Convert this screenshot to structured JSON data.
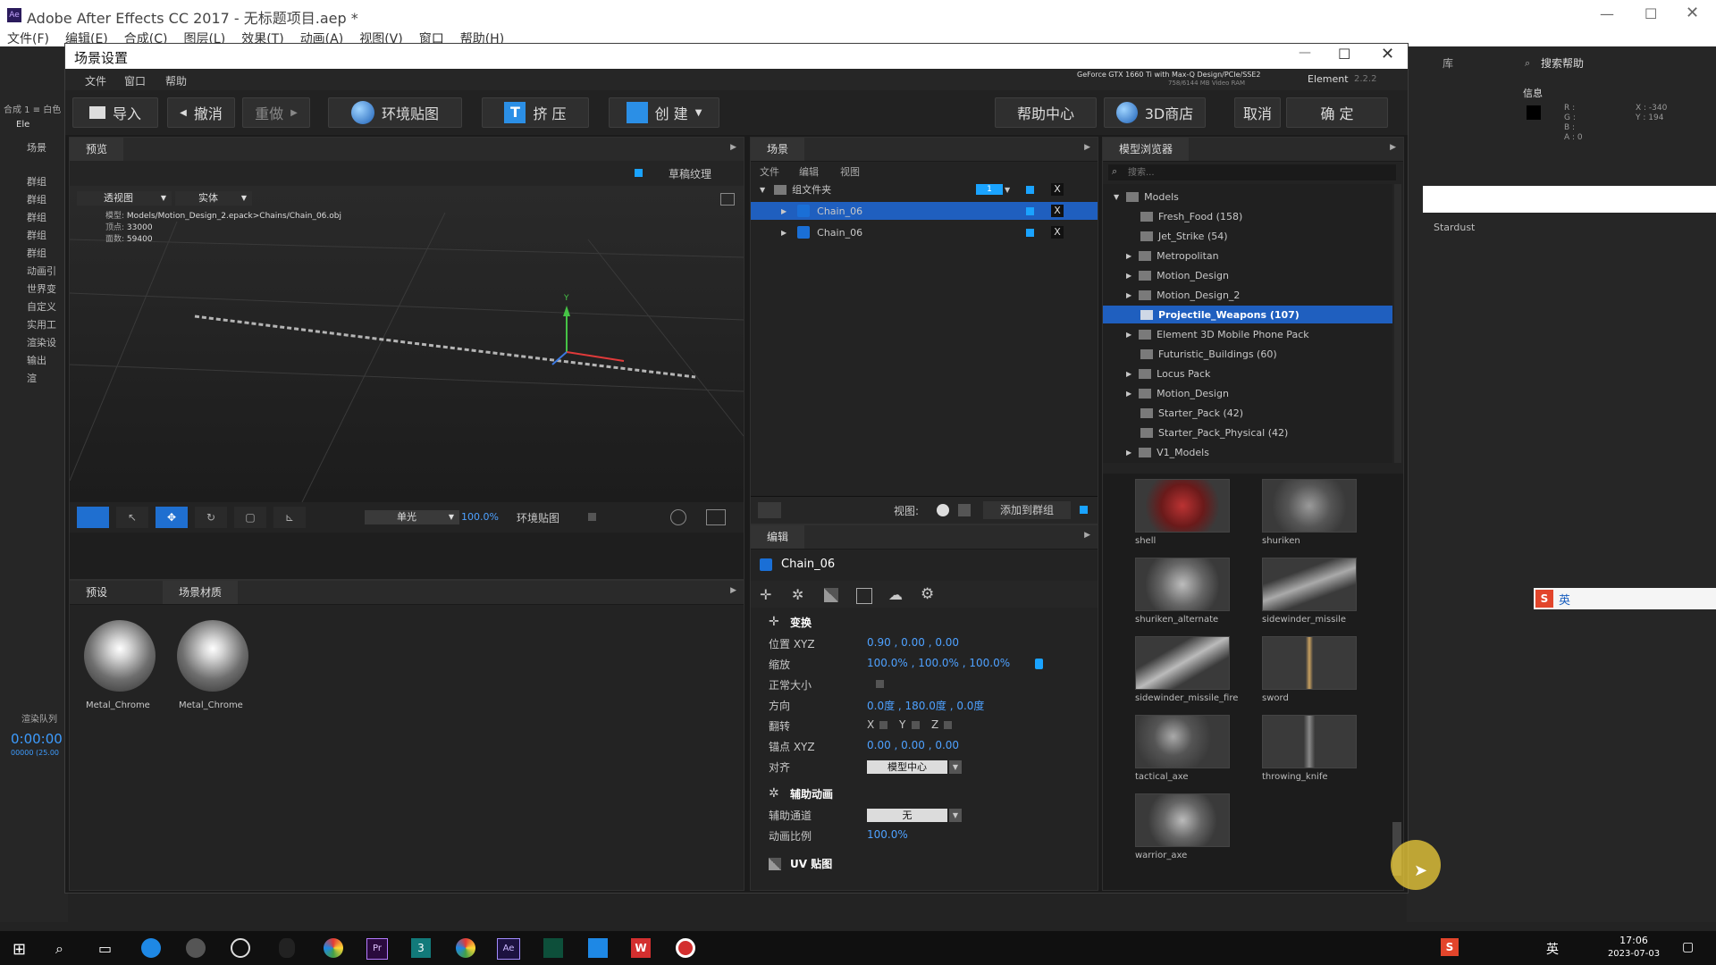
{
  "ae": {
    "title": "Adobe After Effects CC 2017 - 无标题项目.aep *",
    "menu": [
      "文件(F)",
      "编辑(E)",
      "合成(C)",
      "图层(L)",
      "效果(T)",
      "动画(A)",
      "视图(V)",
      "窗口",
      "帮助(H)"
    ],
    "search_label": "搜索帮助",
    "library_label": "库",
    "info_label": "信息",
    "info_rgba": [
      "R :",
      "G :",
      "B :",
      "A : 0"
    ],
    "info_x": "X : -340",
    "info_y": "Y : 194",
    "stardust_label": "Stardust",
    "left_panel": {
      "comp": "合成 1 ≡ 白色",
      "fx": "Ele",
      "items": [
        "场景",
        "群组",
        "群组",
        "群组",
        "群组",
        "群组",
        "动画引",
        "世界变",
        "自定义",
        "实用工",
        "渲染设",
        "输出",
        "渲"
      ],
      "render": "渲染队列",
      "timecode": "0:00:00",
      "timecode_sub": "00000 (25.00"
    }
  },
  "dialog": {
    "title": "场景设置",
    "menu": [
      "文件",
      "窗口",
      "帮助"
    ],
    "gpu": "GeForce GTX 1660 Ti with Max-Q Design/PCIe/SSE2",
    "gpu_mem": "758/6144 MB Video RAM",
    "element": "Element",
    "element_ver": "2.2.2",
    "toolbar": {
      "import": "导入",
      "undo": "撤消",
      "redo": "重做",
      "env": "环境贴图",
      "extrude": "挤 压",
      "create": "创 建",
      "help": "帮助中心",
      "store": "3D商店",
      "cancel": "取消",
      "ok": "确 定"
    }
  },
  "preview": {
    "tab": "预览",
    "draft": "草稿纹理",
    "view": "透视图",
    "shade": "实体",
    "info_model_label": "模型:",
    "info_model": "Models/Motion_Design_2.epack>Chains/Chain_06.obj",
    "info_vert_label": "顶点:",
    "info_vert": "33000",
    "info_face_label": "面数:",
    "info_face": "59400",
    "light": "单光",
    "zoom": "100.0%",
    "envmap": "环境贴图"
  },
  "presets": {
    "tab1": "预设",
    "tab2": "场景材质",
    "materials": [
      "Metal_Chrome",
      "Metal_Chrome"
    ]
  },
  "scene": {
    "tab": "场景",
    "menu": [
      "文件",
      "编辑",
      "视图"
    ],
    "group": "组文件夹",
    "group_badge": "1",
    "items": [
      "Chain_06",
      "Chain_06"
    ],
    "x": "X",
    "view_label": "视图:",
    "add_group": "添加到群组"
  },
  "edit": {
    "tab": "编辑",
    "object": "Chain_06",
    "transform": "变换",
    "rows": [
      {
        "label": "位置 XYZ",
        "value": "0.90 ,  0.00 ,  0.00"
      },
      {
        "label": "缩放",
        "value": "100.0% ,  100.0% ,  100.0%"
      },
      {
        "label": "正常大小",
        "value": ""
      },
      {
        "label": "方向",
        "value": "0.0度 ,  180.0度 ,  0.0度"
      },
      {
        "label": "翻转",
        "value": ""
      },
      {
        "label": "锚点 XYZ",
        "value": "0.00 ,  0.00 ,  0.00"
      },
      {
        "label": "对齐",
        "value": ""
      }
    ],
    "flip_labels": [
      "X",
      "Y",
      "Z"
    ],
    "align_value": "模型中心",
    "aux": "辅助动画",
    "aux_channel_label": "辅助通道",
    "aux_channel_value": "无",
    "anim_ratio_label": "动画比例",
    "anim_ratio_value": "100.0%",
    "uv": "UV 贴图"
  },
  "browser": {
    "tab": "模型浏览器",
    "search_placeholder": "搜索...",
    "root": "Models",
    "folders": [
      "Fresh_Food (158)",
      "Jet_Strike (54)",
      "Metropolitan",
      "Motion_Design",
      "Motion_Design_2",
      "Projectile_Weapons (107)",
      "Element 3D Mobile Phone Pack",
      "Futuristic_Buildings (60)",
      "Locus Pack",
      "Motion_Design",
      "Starter_Pack (42)",
      "Starter_Pack_Physical (42)",
      "V1_Models"
    ],
    "thumbs": [
      "shell",
      "shuriken",
      "shuriken_alternate",
      "sidewinder_missile",
      "sidewinder_missile_fire",
      "sword",
      "tactical_axe",
      "throwing_knife",
      "warrior_axe"
    ]
  },
  "taskbar": {
    "time": "17:06",
    "date": "2023-07-03",
    "ime": "英"
  }
}
